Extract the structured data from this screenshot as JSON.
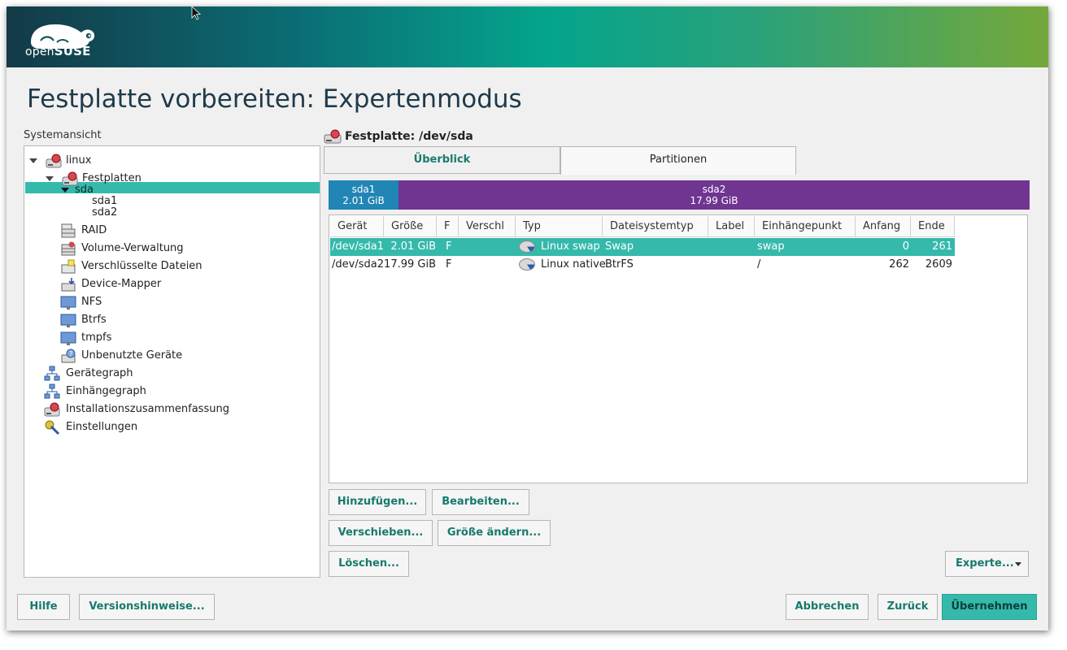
{
  "header": {
    "logo_text_light": "open",
    "logo_text_bold": "SUSE",
    "title": "Festplatte vorbereiten: Expertenmodus"
  },
  "sidebar": {
    "label": "Systemansicht",
    "items": [
      {
        "label": "linux",
        "icon": "harddisk-icon"
      },
      {
        "label": "Festplatten",
        "icon": "harddisk-icon"
      },
      {
        "label": "sda",
        "icon": "none"
      },
      {
        "label": "sda1",
        "icon": "none"
      },
      {
        "label": "sda2",
        "icon": "none"
      },
      {
        "label": "RAID",
        "icon": "raid-icon"
      },
      {
        "label": "Volume-Verwaltung",
        "icon": "lvm-icon"
      },
      {
        "label": "Verschlüsselte Dateien",
        "icon": "encrypted-files-icon"
      },
      {
        "label": "Device-Mapper",
        "icon": "device-mapper-icon"
      },
      {
        "label": "NFS",
        "icon": "network-folder-icon"
      },
      {
        "label": "Btrfs",
        "icon": "folder-icon"
      },
      {
        "label": "tmpfs",
        "icon": "folder-icon"
      },
      {
        "label": "Unbenutzte Geräte",
        "icon": "unused-devices-icon"
      },
      {
        "label": "Gerätegraph",
        "icon": "graph-icon"
      },
      {
        "label": "Einhängegraph",
        "icon": "graph-icon"
      },
      {
        "label": "Installationszusammenfassung",
        "icon": "harddisk-icon"
      },
      {
        "label": "Einstellungen",
        "icon": "settings-icon"
      }
    ]
  },
  "disk": {
    "heading_prefix": "Festplatte:",
    "heading_device": "/dev/sda",
    "tabs": [
      {
        "label": "Überblick",
        "active": false
      },
      {
        "label": "Partitionen",
        "active": true
      }
    ],
    "bar": [
      {
        "name": "sda1",
        "size": "2.01 GiB",
        "color": "#2185b5"
      },
      {
        "name": "sda2",
        "size": "17.99 GiB",
        "color": "#6f3591"
      }
    ]
  },
  "partition_table": {
    "columns": [
      "Gerät",
      "Größe",
      "F",
      "Verschl",
      "Typ",
      "Dateisystemtyp",
      "Label",
      "Einhängepunkt",
      "Anfang",
      "Ende"
    ],
    "rows": [
      {
        "device": "/dev/sda1",
        "size": "2.01 GiB",
        "f": "F",
        "encrypted": "",
        "type": "Linux swap",
        "fs": "Swap",
        "label": "",
        "mount": "swap",
        "start": "0",
        "end": "261",
        "selected": true
      },
      {
        "device": "/dev/sda2",
        "size": "17.99 GiB",
        "f": "F",
        "encrypted": "",
        "type": "Linux native",
        "fs": "BtrFS",
        "label": "",
        "mount": "/",
        "start": "262",
        "end": "2609",
        "selected": false
      }
    ]
  },
  "actions": {
    "add": "Hinzufügen...",
    "edit": "Bearbeiten...",
    "move": "Verschieben...",
    "resize": "Größe ändern...",
    "delete": "Löschen...",
    "expert": "Experte..."
  },
  "footer": {
    "help": "Hilfe",
    "release_notes": "Versionshinweise...",
    "abort": "Abbrechen",
    "back": "Zurück",
    "accept": "Übernehmen"
  },
  "colors": {
    "accent": "#35b9ab",
    "button_text": "#177a6d",
    "sda1": "#2185b5",
    "sda2": "#6f3591"
  }
}
